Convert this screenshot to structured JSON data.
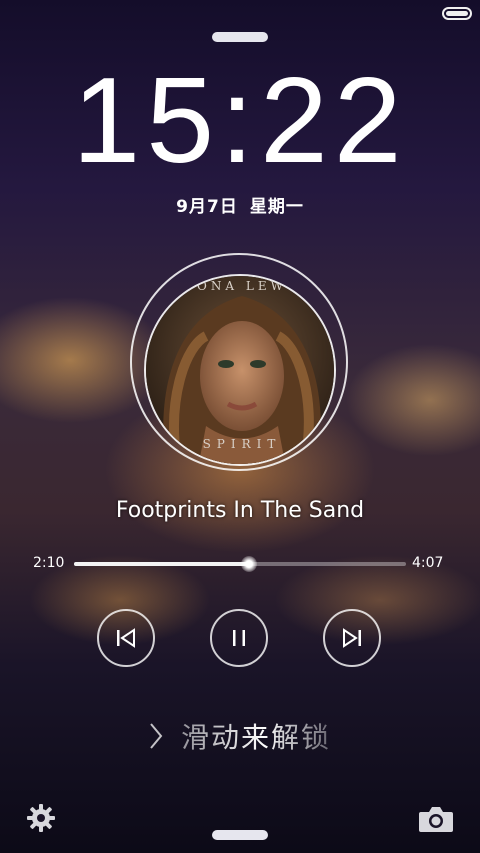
{
  "lockscreen": {
    "time": "15:22",
    "date": "9月7日",
    "weekday": "星期一",
    "unlock_text": "滑动来解锁"
  },
  "player": {
    "album_text_top": "ONA LEW",
    "album_text_bottom": "SPIRIT",
    "song_title": "Footprints In The Sand",
    "elapsed": "2:10",
    "duration": "4:07",
    "progress_percent": 52.6
  },
  "icons": {
    "settings": "gear-icon",
    "camera": "camera-icon",
    "previous": "skip-previous-icon",
    "pause": "pause-icon",
    "next": "skip-next-icon",
    "unlock": "chevron-right-icon",
    "battery": "battery-icon"
  },
  "colors": {
    "accent": "#ffffff",
    "background_top": "#140d2a",
    "city_light": "#ffbe5a"
  }
}
